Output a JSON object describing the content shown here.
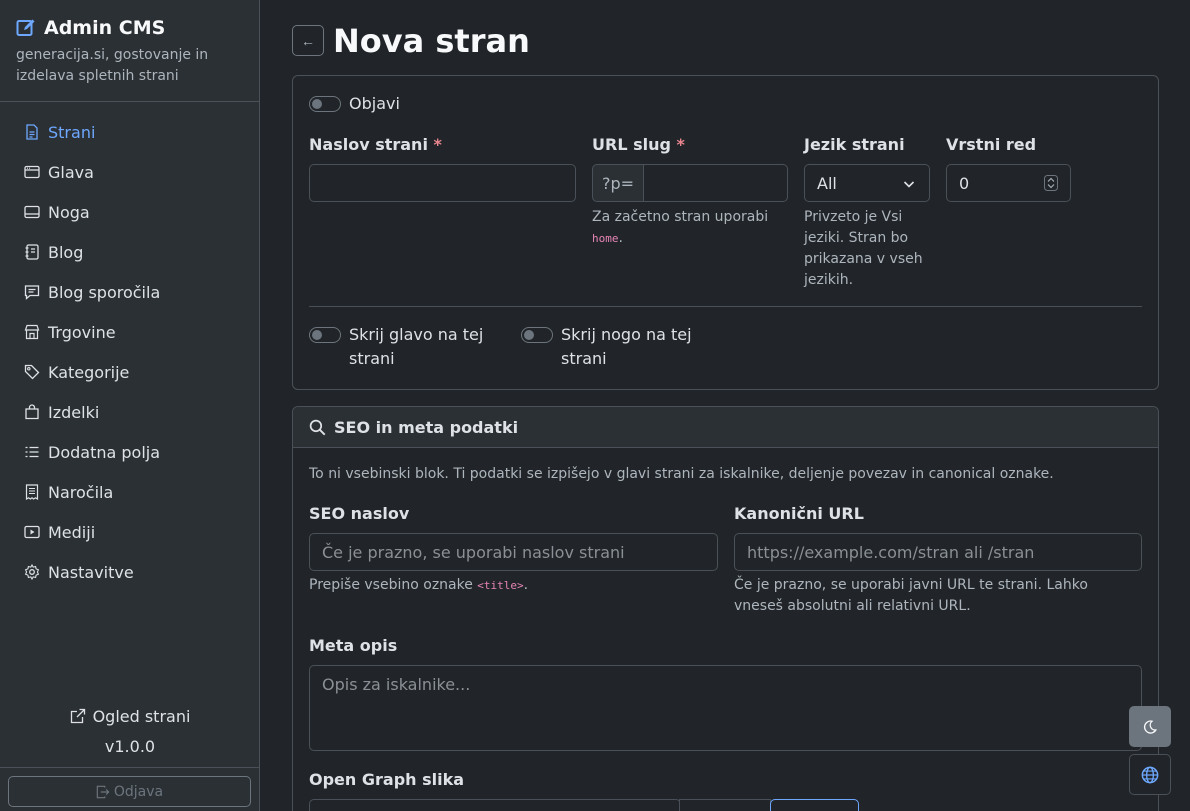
{
  "sidebar": {
    "brand_title": "Admin CMS",
    "brand_sub": "generacija.si, gostovanje in izdelava spletnih strani",
    "items": [
      {
        "label": "Strani",
        "icon": "file-icon",
        "active": true
      },
      {
        "label": "Glava",
        "icon": "window-icon"
      },
      {
        "label": "Noga",
        "icon": "window-icon"
      },
      {
        "label": "Blog",
        "icon": "journal-icon"
      },
      {
        "label": "Blog sporočila",
        "icon": "chat-icon"
      },
      {
        "label": "Trgovine",
        "icon": "shop-icon"
      },
      {
        "label": "Kategorije",
        "icon": "tags-icon"
      },
      {
        "label": "Izdelki",
        "icon": "bag-icon"
      },
      {
        "label": "Dodatna polja",
        "icon": "list-icon"
      },
      {
        "label": "Naročila",
        "icon": "receipt-icon"
      },
      {
        "label": "Mediji",
        "icon": "video-icon"
      },
      {
        "label": "Nastavitve",
        "icon": "gear-icon"
      }
    ],
    "preview_label": "Ogled strani",
    "version": "v1.0.0",
    "logout_label": "Odjava"
  },
  "header": {
    "back_label": "←",
    "title": "Nova stran"
  },
  "general": {
    "publish_label": "Objavi",
    "title_label": "Naslov strani",
    "slug_label": "URL slug",
    "required_mark": "*",
    "slug_prefix": "?p=",
    "slug_help": "Za začetno stran uporabi",
    "slug_help_code": "home",
    "slug_help_end": ".",
    "language_label": "Jezik strani",
    "language_value": "All",
    "language_help": "Privzeto je Vsi jeziki. Stran bo prikazana v vseh jezikih.",
    "order_label": "Vrstni red",
    "order_value": "0",
    "hide_header_label": "Skrij glavo na tej strani",
    "hide_footer_label": "Skrij nogo na tej strani"
  },
  "seo": {
    "header": "SEO in meta podatki",
    "intro": "To ni vsebinski blok. Ti podatki se izpišejo v glavi strani za iskalnike, deljenje povezav in canonical oznake.",
    "seo_title_label": "SEO naslov",
    "seo_title_placeholder": "Če je prazno, se uporabi naslov strani",
    "seo_title_help": "Prepiše vsebino oznake",
    "seo_title_help_code": "<title>",
    "seo_title_help_end": ".",
    "canonical_label": "Kanonični URL",
    "canonical_placeholder": "https://example.com/stran ali /stran",
    "canonical_help": "Če je prazno, se uporabi javni URL te strani. Lahko vneseš absolutni ali relativni URL.",
    "meta_label": "Meta opis",
    "meta_placeholder": "Opis za iskalnike...",
    "og_label": "Open Graph slika"
  },
  "colors": {
    "accent": "#6ea8fe",
    "bg": "#212529",
    "sidebar_bg": "#2b3035"
  }
}
